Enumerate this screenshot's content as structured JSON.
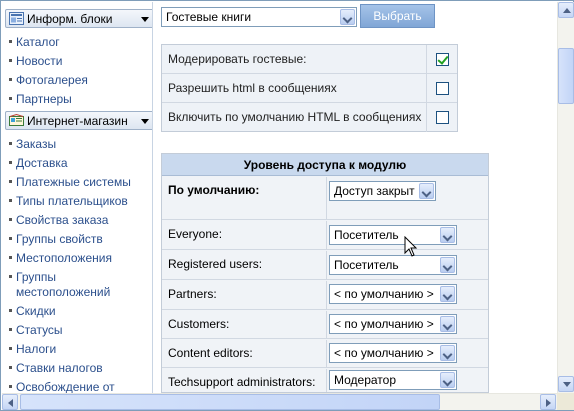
{
  "colors": {
    "accent": "#7f9db9",
    "link": "#2b4f8c",
    "button": "#8cb0dd",
    "table_header": "#c9d9ee",
    "check_mark": "#21a121"
  },
  "sidebar": {
    "sections": [
      {
        "title": "Информ. блоки",
        "icon": "info-blocks-icon",
        "items": [
          "Каталог",
          "Новости",
          "Фотогалерея",
          "Партнеры"
        ]
      },
      {
        "title": "Интернет-магазин",
        "icon": "shop-icon",
        "items": [
          "Заказы",
          "Доставка",
          "Платежные системы",
          "Типы плательщиков",
          "Свойства заказа",
          "Группы свойств",
          "Местоположения",
          "Группы",
          "местоположений",
          "Скидки",
          "Статусы",
          "Налоги",
          "Ставки налогов",
          "Освобождение от"
        ]
      }
    ]
  },
  "module_select": {
    "value": "Гостевые книги",
    "button_label": "Выбрать"
  },
  "options": [
    {
      "label": "Модерировать гостевые:",
      "checked": true
    },
    {
      "label": "Разрешить html в сообщениях",
      "checked": false
    },
    {
      "label": "Включить по умолчанию HTML в сообщениях",
      "checked": false
    }
  ],
  "access": {
    "title": "Уровень доступа к модулю",
    "rows": [
      {
        "group": "По умолчанию:",
        "level": "Доступ закрыт"
      },
      {
        "group": "Everyone:",
        "level": "Посетитель"
      },
      {
        "group": "Registered users:",
        "level": "Посетитель"
      },
      {
        "group": "Partners:",
        "level": "< по умолчанию >"
      },
      {
        "group": "Customers:",
        "level": "< по умолчанию >"
      },
      {
        "group": "Content editors:",
        "level": "< по умолчанию >"
      },
      {
        "group": "Techsupport administrators:",
        "level": "Модератор"
      }
    ]
  }
}
